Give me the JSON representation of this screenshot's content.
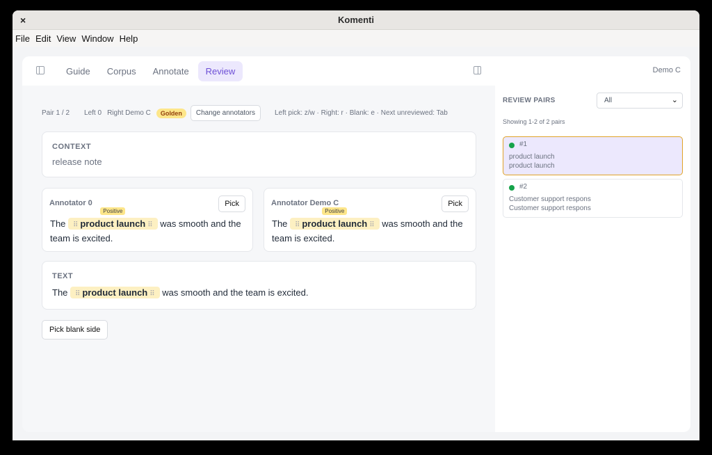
{
  "window": {
    "title": "Komenti",
    "close_glyph": "×"
  },
  "menubar": [
    "File",
    "Edit",
    "View",
    "Window",
    "Help"
  ],
  "nav": {
    "tabs": [
      "Guide",
      "Corpus",
      "Annotate",
      "Review"
    ],
    "active_tab": "Review",
    "user": "Demo C"
  },
  "infobar": {
    "pair": "Pair 1 / 2",
    "left": "Left 0",
    "right": "Right Demo C",
    "golden": "Golden",
    "change_button": "Change annotators",
    "shortcuts": "Left pick: z/w · Right: r · Blank: e · Next unreviewed: Tab"
  },
  "context": {
    "label": "CONTEXT",
    "value": "release note"
  },
  "annotators": [
    {
      "label": "Annotator 0",
      "pick": "Pick",
      "prefix": "The",
      "span": "product launch",
      "tag": "Positive",
      "suffix": "was smooth and the team is excited."
    },
    {
      "label": "Annotator Demo C",
      "pick": "Pick",
      "prefix": "The",
      "span": "product launch",
      "tag": "Positive",
      "suffix": "was smooth and the team is excited."
    }
  ],
  "text_card": {
    "label": "TEXT",
    "prefix": "The",
    "span": "product launch",
    "suffix": "was smooth and the team is excited."
  },
  "blank_button": "Pick blank side",
  "review_pairs": {
    "title": "REVIEW PAIRS",
    "filter": "All",
    "count": "Showing 1-2 of 2 pairs",
    "items": [
      {
        "num": "#1",
        "left": "product launch",
        "right": "product launch",
        "status_color": "#16a34a"
      },
      {
        "num": "#2",
        "left": "Customer support respons",
        "right": "Customer support respons",
        "status_color": "#16a34a"
      }
    ]
  },
  "colors": {
    "accent": "#6d4fd6",
    "golden": "#fde68a",
    "highlight": "#fdf0c2",
    "selected_border": "#e0a327"
  },
  "icons": {
    "drag_handle": "⠿",
    "chevron": "⌄"
  }
}
